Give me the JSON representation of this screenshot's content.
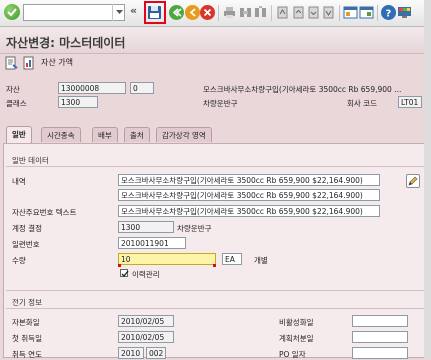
{
  "toolbar": {
    "command_value": "",
    "collapse_label": "«"
  },
  "header": {
    "title": "자산변경: 마스터데이터"
  },
  "subtoolbar": {
    "asset_value_label": "자산 가액"
  },
  "asset": {
    "asset_label": "자산",
    "asset_number": "13000008",
    "sub_number": "0",
    "asset_desc": "모스크바사무소차량구입(기아세라토 3500cc Rb 659,900 ...",
    "class_label": "클래스",
    "class_value": "1300",
    "class_desc": "차량운반구",
    "company_code_label": "회사 코드",
    "company_code": "LT01"
  },
  "tabs": [
    {
      "label": "일반"
    },
    {
      "label": "시간종속"
    },
    {
      "label": "배부"
    },
    {
      "label": "출처"
    },
    {
      "label": "감가상각 영역"
    }
  ],
  "general": {
    "group_title": "일반 데이터",
    "desc_label": "내역",
    "desc_line1": "모스크바사무소차량구입(기아세라토 3500cc Rb 659,900 $22,164.900)",
    "desc_line2": "모스크바사무소차량구입(기아세라토 3500cc Rb 659,900 $22,164.900)",
    "main_no_text_label": "자산주요번호 텍스트",
    "main_no_text": "모스크바사무소차량구입(기아세라토 3500cc Rb 659,900 $22,164.900)",
    "account_det_label": "계정 결정",
    "account_det": "1300",
    "account_det_desc": "차량운반구",
    "serial_label": "일련번호",
    "serial": "2010011901",
    "qty_label": "수량",
    "qty": "10",
    "unit": "EA",
    "unit_desc": "개별",
    "history_label": "이력관리",
    "history_checked": true
  },
  "posting": {
    "group_title": "전기 정보",
    "cap_date_label": "자본화일",
    "cap_date": "2010/02/05",
    "deact_label": "비활성화일",
    "deact": "",
    "first_acq_label": "첫 취득일",
    "first_acq": "2010/02/05",
    "planned_ret_label": "계획처분일",
    "planned_ret": "",
    "acq_year_label": "취득 연도",
    "acq_year": "2010",
    "acq_period": "002",
    "po_date_label": "PO 일자",
    "po_date": ""
  },
  "colors": {
    "accent_red": "#e3061a",
    "background": "#e9d7da"
  }
}
